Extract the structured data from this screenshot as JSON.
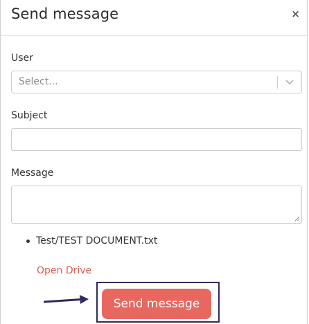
{
  "modal": {
    "title": "Send message",
    "close_symbol": "×"
  },
  "form": {
    "user": {
      "label": "User",
      "placeholder": "Select..."
    },
    "subject": {
      "label": "Subject",
      "value": ""
    },
    "message": {
      "label": "Message",
      "value": ""
    }
  },
  "attachments": [
    "Test/TEST DOCUMENT.txt"
  ],
  "drive_link": "Open Drive",
  "send_button": "Send message",
  "colors": {
    "accent": "#e8685f",
    "link": "#e05a4f",
    "highlight_border": "#2e2a5e"
  },
  "icons": {
    "close": "close-icon",
    "dropdown": "chevron-down-icon",
    "pointer": "arrow-right-icon"
  }
}
